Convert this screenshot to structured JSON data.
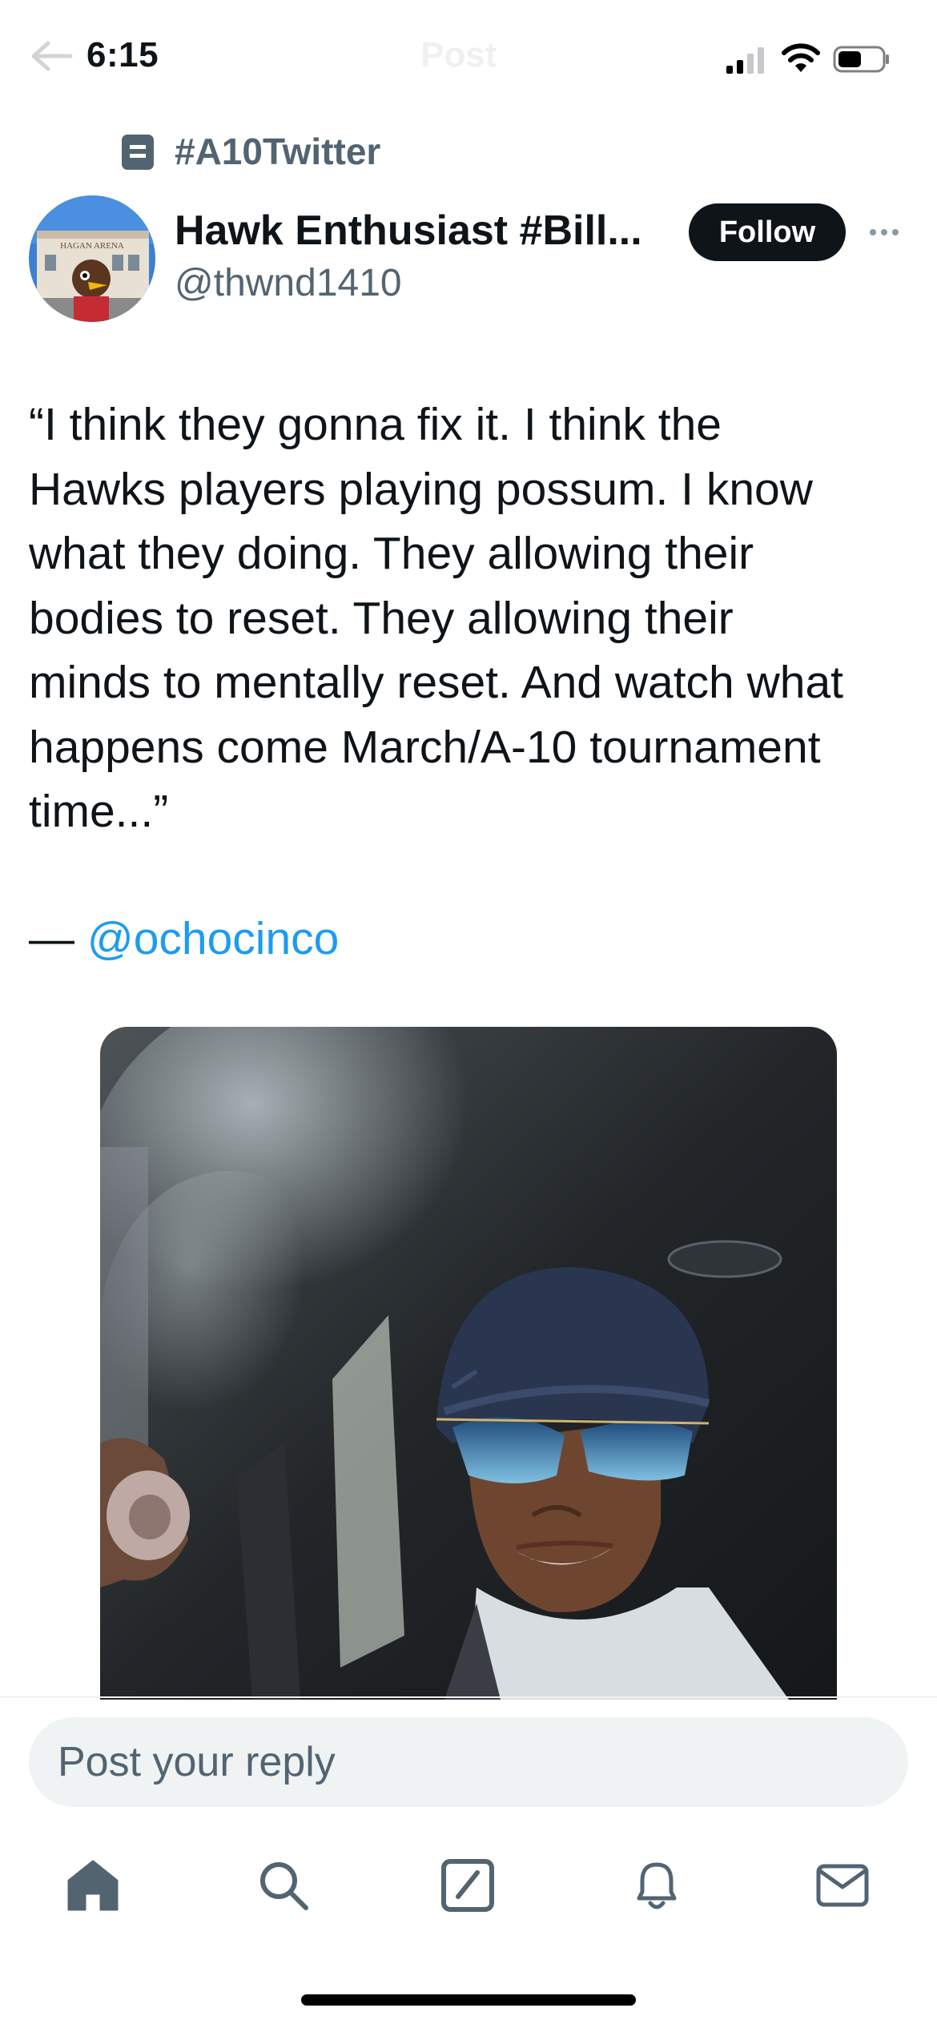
{
  "status_bar": {
    "time": "6:15",
    "faded_header_title": "Post"
  },
  "community": {
    "icon": "community-icon",
    "name": "#A10Twitter"
  },
  "author": {
    "display_name": "Hawk Enthusiast #Bill...",
    "handle": "@thwnd1410",
    "follow_label": "Follow",
    "avatar": "avatar-hawk-mascot"
  },
  "tweet": {
    "text": "“I think they gonna fix it. I think the\nHawks players playing possum. I know\nwhat they doing. They allowing their\nbodies to reset. They allowing their\nminds to mentally reset. And watch what\nhappens come March/A-10 tournament\ntime...”",
    "attribution_dash": "— ",
    "mention": "@ochocinco"
  },
  "media": {
    "type": "video-thumbnail",
    "description_icon": "person-in-car-smoking"
  },
  "reply": {
    "placeholder": "Post your reply"
  },
  "tab_bar": [
    {
      "icon": "home-icon",
      "active": true
    },
    {
      "icon": "search-icon",
      "active": false
    },
    {
      "icon": "compose-icon",
      "active": false
    },
    {
      "icon": "bell-icon",
      "active": false
    },
    {
      "icon": "mail-icon",
      "active": false
    }
  ],
  "colors": {
    "text": "#0f1419",
    "secondary": "#536471",
    "link": "#1d9bf0",
    "input_bg": "#eff3f4"
  }
}
